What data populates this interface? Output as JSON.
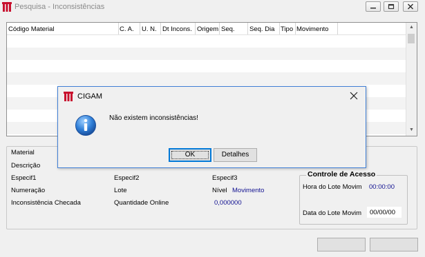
{
  "window": {
    "title": "Pesquisa - Inconsistências",
    "controls": [
      "minimize-icon",
      "restore-icon",
      "close-icon"
    ],
    "brand_color": "#c8102e"
  },
  "grid": {
    "columns": [
      "Código Material",
      "C. A.",
      "U. N.",
      "Dt Incons.",
      "Origem",
      "Seq.",
      "Seq. Dia",
      "Tipo",
      "Movimento"
    ],
    "rows": []
  },
  "details": {
    "material_label": "Material",
    "descricao_label": "Descrição",
    "especif1_label": "Especif1",
    "especif2_label": "Especif2",
    "especif3_label": "Especif3",
    "numeracao_label": "Numeração",
    "lote_label": "Lote",
    "nivel_label": "Nível",
    "nivel_value": "Movimento",
    "inconsistencia_label": "Inconsistência Checada",
    "quantidade_label": "Quantidade Online",
    "quantidade_value": "0,000000"
  },
  "controle": {
    "title": "Controle de Acesso",
    "hora_label": "Hora do Lote Movim",
    "hora_value": "00:00:00",
    "data_label": "Data do Lote Movim",
    "data_value": "00/00/00"
  },
  "dialog": {
    "title": "CIGAM",
    "message": "Não existem inconsistências!",
    "ok_label": "OK",
    "details_label": "Detalhes",
    "icon": "info-icon",
    "accent": "#3f7fd6"
  }
}
